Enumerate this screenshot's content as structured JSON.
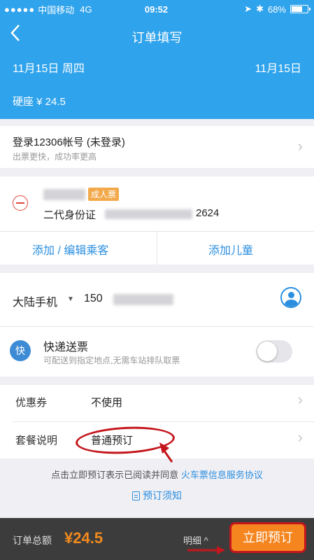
{
  "status_bar": {
    "carrier": "中国移动",
    "network": "4G",
    "time": "09:52",
    "battery": "68%",
    "battery_level": 0.68
  },
  "header": {
    "back_icon": "chevron-left-icon",
    "title": "订单填写",
    "date_left": "11月15日 周四",
    "date_right": "11月15日",
    "seat_info": "硬座 ¥ 24.5"
  },
  "login": {
    "title": "登录12306帐号 (未登录)",
    "subtitle": "出票更快，成功率更高"
  },
  "passenger": {
    "ticket_type": "成人票",
    "id_type": "二代身份证",
    "id_suffix": "2624",
    "add_edit": "添加 / 编辑乘客",
    "add_child": "添加儿童"
  },
  "contact": {
    "phone_type": "大陆手机",
    "phone_prefix": "150"
  },
  "express": {
    "icon_text": "快",
    "title": "快递送票",
    "subtitle": "可配送到指定地点,无需车站排队取票"
  },
  "options": {
    "coupon_label": "优惠券",
    "coupon_value": "不使用",
    "package_label": "套餐说明",
    "package_value": "普通预订"
  },
  "notice": {
    "prefix": "点击立即预订表示已阅读并同意",
    "link": "火车票信息服务协议",
    "must_read": "预订须知"
  },
  "footer": {
    "total_label": "订单总额",
    "total_value": "¥24.5",
    "detail": "明细 ^",
    "book_button": "立即预订"
  },
  "colors": {
    "header_bg": "#2fa3ec",
    "link": "#2b8fe0",
    "accent_orange": "#f5851f",
    "annotation_red": "#c4161c"
  }
}
